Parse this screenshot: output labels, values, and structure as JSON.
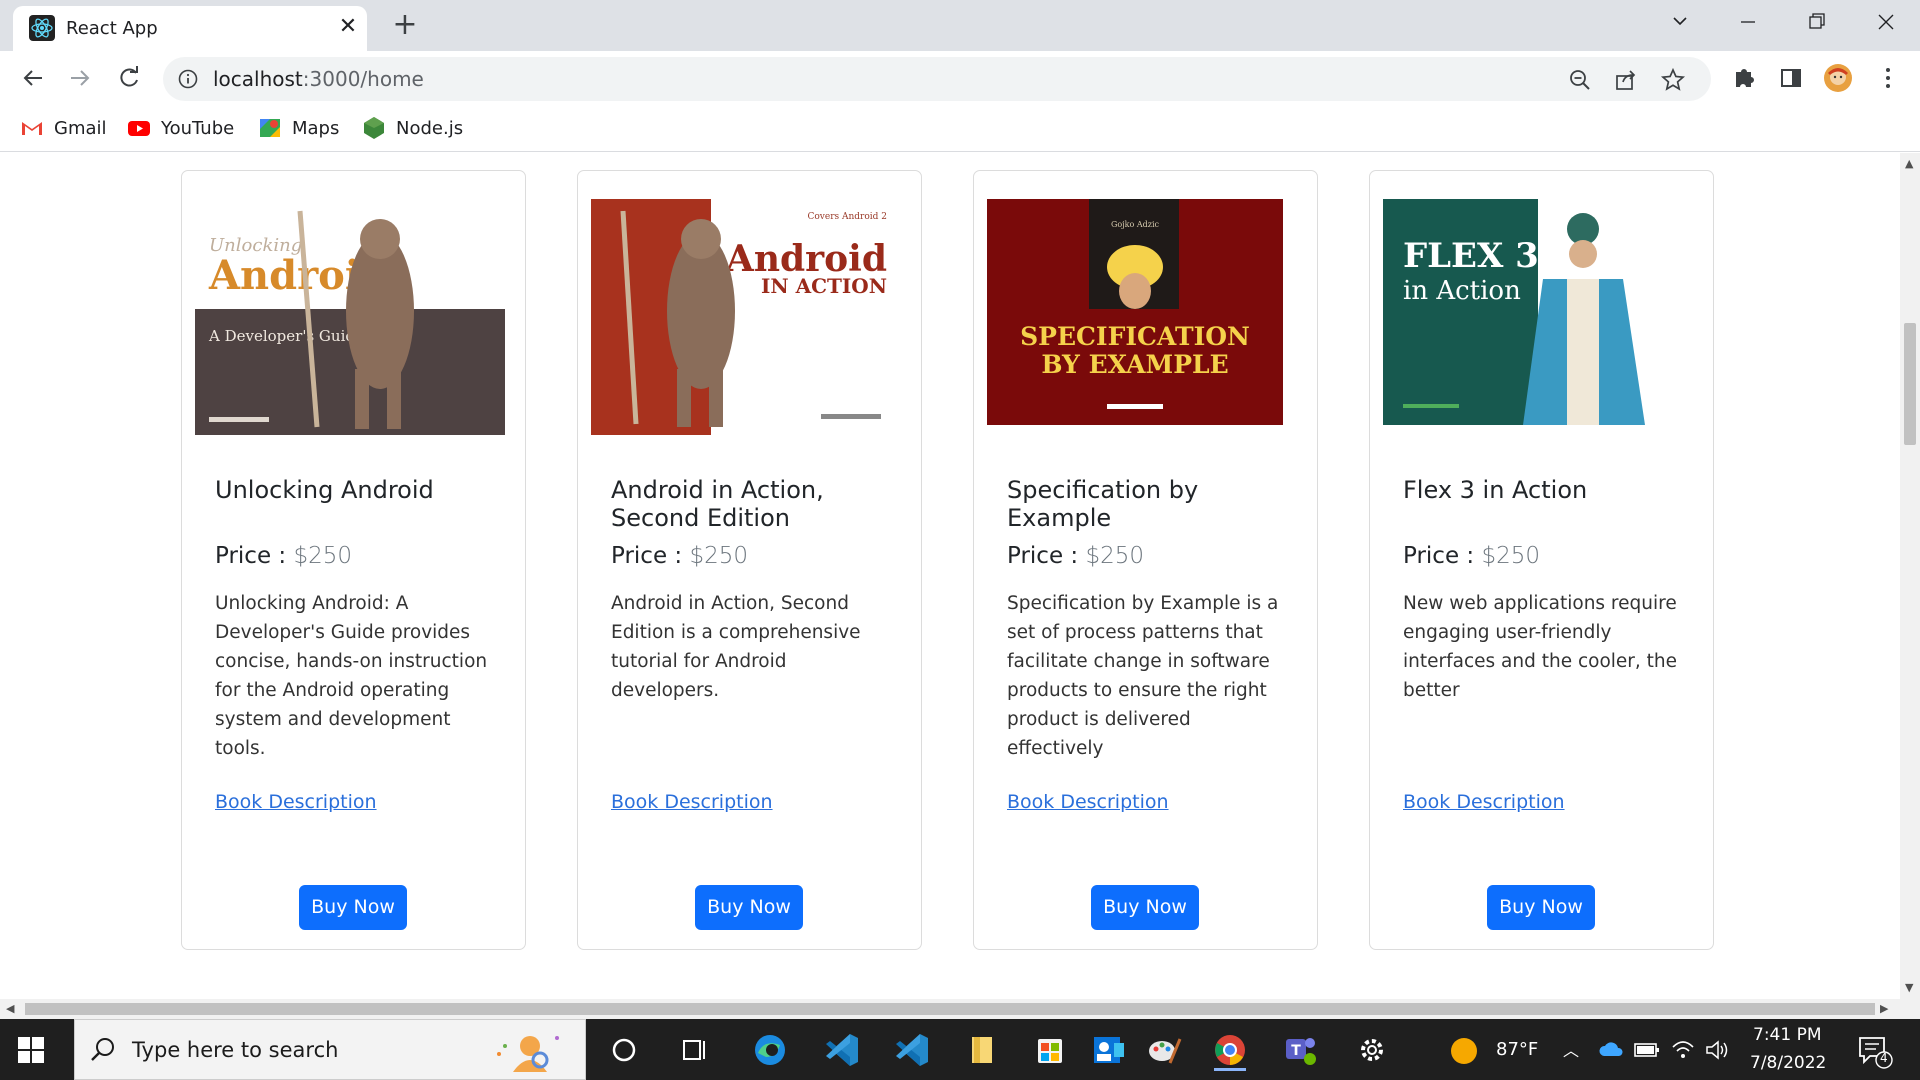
{
  "browser": {
    "tab": {
      "title": "React App",
      "close_label": "✕"
    },
    "new_tab_label": "+",
    "url_host": "localhost",
    "url_path": ":3000/home",
    "bookmarks": [
      {
        "label": "Gmail",
        "icon": "gmail-icon"
      },
      {
        "label": "YouTube",
        "icon": "youtube-icon"
      },
      {
        "label": "Maps",
        "icon": "maps-icon"
      },
      {
        "label": "Node.js",
        "icon": "nodejs-icon"
      }
    ]
  },
  "books": [
    {
      "title": "Unlocking Android",
      "price_label": "Price : ",
      "price": "$250",
      "description": "Unlocking Android: A Developer's Guide provides concise, hands-on instruction for the Android operating system and development tools.",
      "link_label": "Book Description",
      "buy_label": "Buy Now",
      "cover": {
        "big": "Android",
        "small_top": "Unlocking",
        "sub": "A Developer's Guide",
        "bg": "#4e4242",
        "accent": "#d78a2a"
      }
    },
    {
      "title": "Android in Action, Second Edition",
      "price_label": "Price : ",
      "price": "$250",
      "description": "Android in Action, Second Edition is a comprehensive tutorial for Android developers.",
      "link_label": "Book Description",
      "buy_label": "Buy Now",
      "cover": {
        "big": "Android",
        "small_top": "Covers Android 2",
        "sub": "IN ACTION",
        "bg": "#a8321e",
        "accent": "#ffffff"
      }
    },
    {
      "title": "Specification by Example",
      "price_label": "Price : ",
      "price": "$250",
      "description": "Specification by Example is a set of process patterns that facilitate change in software products to ensure the right product is delivered effectively",
      "link_label": "Book Description",
      "buy_label": "Buy Now",
      "cover": {
        "big": "SPECIFICATION",
        "small_top": "Gojko Adzic",
        "sub": "BY EXAMPLE",
        "bg": "#7a0a0a",
        "accent": "#f5d24b"
      }
    },
    {
      "title": "Flex 3 in Action",
      "price_label": "Price : ",
      "price": "$250",
      "description": "New web applications require engaging user-friendly interfaces and the cooler, the better",
      "link_label": "Book Description",
      "buy_label": "Buy Now",
      "cover": {
        "big": "FLEX 3",
        "small_top": "",
        "sub": "in Action",
        "bg": "#17594f",
        "accent": "#ffffff"
      }
    }
  ],
  "taskbar": {
    "search_placeholder": "Type here to search",
    "weather": "87°F",
    "time": "7:41 PM",
    "date": "7/8/2022",
    "notification_count": "4"
  },
  "colors": {
    "primary_button": "#0d6efd",
    "link": "#2a6fdb"
  }
}
